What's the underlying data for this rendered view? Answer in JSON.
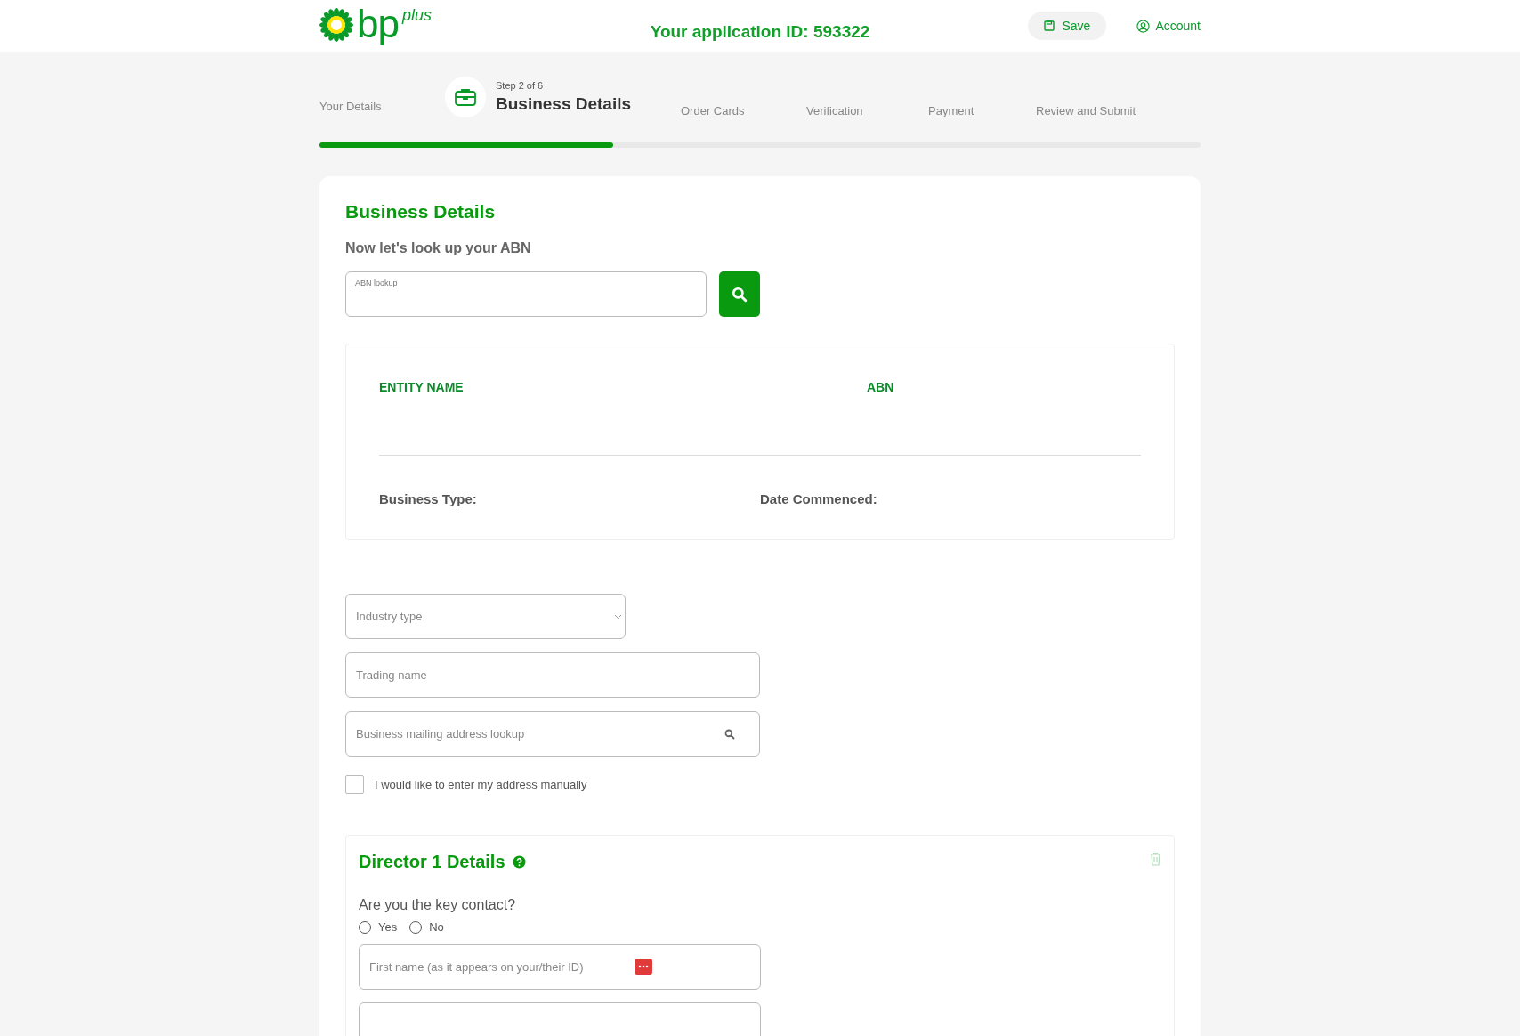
{
  "header": {
    "logo_text": "bp",
    "logo_sub": "plus",
    "application_id": "Your application ID: 593322",
    "save_button": "Save",
    "account_link": "Account"
  },
  "stepper": {
    "step_caption": "Step 2 of 6",
    "steps": [
      {
        "label": "Your Details",
        "selected": false
      },
      {
        "label": "Business Details",
        "selected": true
      },
      {
        "label": "Order Cards",
        "selected": false
      },
      {
        "label": "Verification",
        "selected": false
      },
      {
        "label": "Payment",
        "selected": false
      },
      {
        "label": "Review and Submit",
        "selected": false
      }
    ],
    "progress": {
      "level": 0.333
    }
  },
  "form": {
    "title": "Business Details",
    "subtitle": "Now let's look up your ABN",
    "abn_field": {
      "placeholder": "ABN lookup"
    },
    "result": {
      "columns": [
        "ENTITY NAME",
        "ABN"
      ],
      "labels": [
        "Business Type:",
        "Date Commenced:"
      ]
    },
    "industry_select": {
      "placeholder": "Industry type"
    },
    "trading_name": {
      "placeholder": "Trading name"
    },
    "mailing_address": {
      "placeholder": "Business mailing address lookup"
    },
    "manual_address": {
      "label": "I would like to enter my address manually",
      "checked": false
    },
    "director": {
      "title": "Director 1 Details",
      "question": "Are you the key contact?",
      "options": [
        {
          "label": "Yes",
          "selected": false
        },
        {
          "label": "No",
          "selected": false
        }
      ],
      "first_name": {
        "placeholder": "First name (as it appears on your/their ID)"
      }
    }
  }
}
